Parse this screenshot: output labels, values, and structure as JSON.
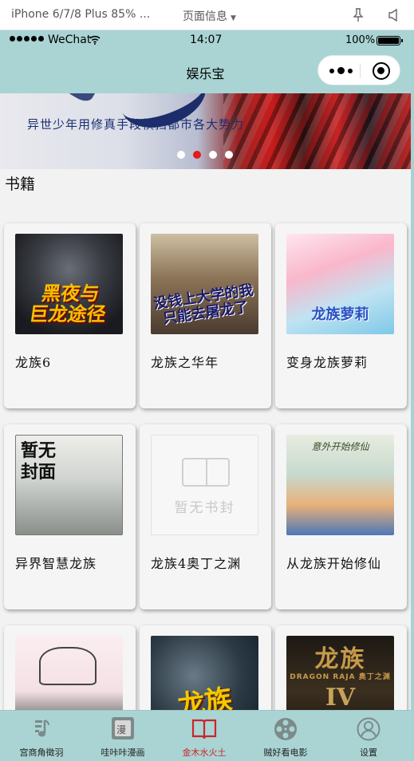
{
  "simulator": {
    "device": "iPhone 6/7/8 Plus 85% ...",
    "page_info": "页面信息",
    "page_info_caret": "▼"
  },
  "status_bar": {
    "carrier": "WeChat",
    "time": "14:07",
    "battery": "100%"
  },
  "navbar": {
    "title": "娱乐宝"
  },
  "banner": {
    "caption": "异世少年用修真手段横扫都市各大势力",
    "slide_count": 4,
    "active_slide": 2
  },
  "section": {
    "title": "书籍"
  },
  "books": [
    {
      "title": "龙族6",
      "cover_text": "黑夜与\n巨龙途径"
    },
    {
      "title": "龙族之华年",
      "cover_text": "没钱上大学的我\n只能去屠龙了"
    },
    {
      "title": "变身龙族萝莉",
      "cover_text": "龙族萝莉"
    },
    {
      "title": "异界智慧龙族",
      "cover_text": "暂无\n封面"
    },
    {
      "title": "龙族4奥丁之渊",
      "cover_text": "暂无书封"
    },
    {
      "title": "从龙族开始修仙",
      "cover_text": "意外开始修仙"
    },
    {
      "title": "",
      "cover_text": ""
    },
    {
      "title": "",
      "cover_text": "龙族"
    },
    {
      "title": "",
      "cover_text": "龙族",
      "cover_sub": "DRAGON RAJA 奥丁之渊",
      "cover_numeral": "IV"
    }
  ],
  "tabbar": {
    "active_index": 2,
    "items": [
      {
        "label": "宫商角徵羽",
        "icon": "music-note-icon"
      },
      {
        "label": "哇咔咔漫画",
        "icon": "comic-icon"
      },
      {
        "label": "金木水火土",
        "icon": "book-icon"
      },
      {
        "label": "贼好看电影",
        "icon": "film-reel-icon"
      },
      {
        "label": "设置",
        "icon": "user-settings-icon"
      }
    ],
    "comic_icon_char": "漫"
  },
  "colors": {
    "theme": "#a9d4d3",
    "active_tab": "#c9252c",
    "active_dot": "#e21b1b"
  }
}
